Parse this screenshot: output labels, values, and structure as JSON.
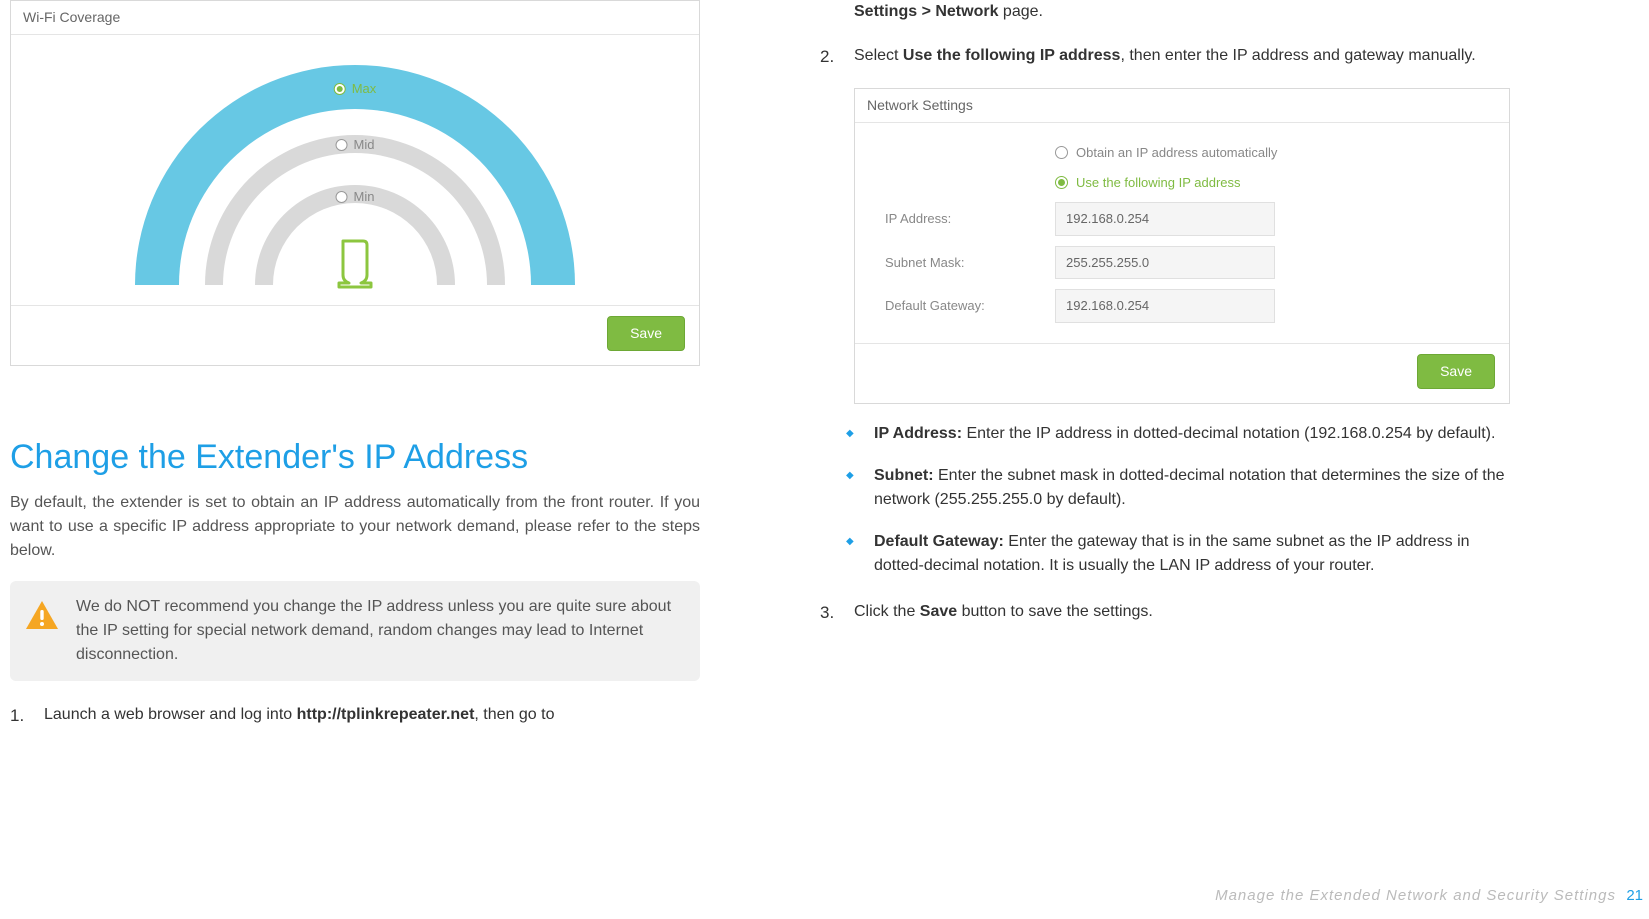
{
  "wifi_panel": {
    "title": "Wi-Fi Coverage",
    "options": {
      "max": "Max",
      "mid": "Mid",
      "min": "Min"
    },
    "save": "Save"
  },
  "section": {
    "title": "Change the Extender's IP Address",
    "intro": "By default, the extender is set to obtain an IP address automatically from the front router. If you want to use a specific IP address appropriate to your network demand, please refer to the steps below.",
    "warning": "We do NOT recommend you change the IP address unless you are quite sure about the IP setting for special network demand, random changes may lead to Internet disconnection."
  },
  "steps": {
    "s1_a": "Launch a web browser and log into ",
    "s1_b": "http://tplinkrepeater.net",
    "s1_c": ", then go to",
    "s1_d": "Settings > Network",
    "s1_e": " page.",
    "s2_a": "Select ",
    "s2_b": "Use the following IP address",
    "s2_c": ", then enter the IP address and gateway manually.",
    "s3_a": "Click the ",
    "s3_b": "Save",
    "s3_c": " button to save the settings."
  },
  "net_panel": {
    "title": "Network Settings",
    "radio_auto": "Obtain an IP address automatically",
    "radio_static": "Use the following IP address",
    "fields": {
      "ip_label": "IP Address:",
      "ip_value": "192.168.0.254",
      "mask_label": "Subnet Mask:",
      "mask_value": "255.255.255.0",
      "gw_label": "Default Gateway:",
      "gw_value": "192.168.0.254"
    },
    "save": "Save"
  },
  "bullets": {
    "b1_a": "IP Address:",
    "b1_b": " Enter the IP address in dotted-decimal notation (192.168.0.254 by default).",
    "b2_a": "Subnet:",
    "b2_b": " Enter the subnet mask in dotted-decimal notation that determines the size of the network (255.255.255.0 by default).",
    "b3_a": "Default Gateway:",
    "b3_b": " Enter the gateway that is in the same subnet as the IP address in dotted-decimal notation. It is usually the LAN IP address of your router."
  },
  "footer": {
    "text": "Manage the Extended Network and Security Settings",
    "page": "21"
  }
}
